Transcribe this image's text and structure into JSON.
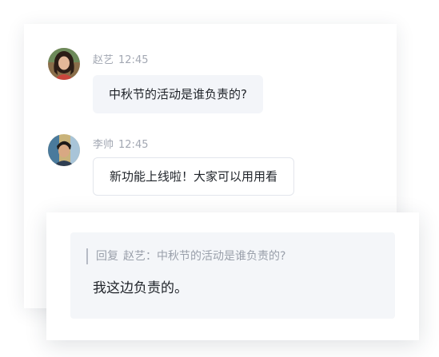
{
  "messages": [
    {
      "sender": "赵艺",
      "time": "12:45",
      "text": "中秋节的活动是谁负责的?",
      "avatar": "avatar-zhaoyi"
    },
    {
      "sender": "李帅",
      "time": "12:45",
      "text": "新功能上线啦！大家可以用用看",
      "avatar": "avatar-lishuai"
    }
  ],
  "reply": {
    "label": "回复",
    "quoted_sender": "赵艺",
    "separator": "：",
    "quoted_text": "中秋节的活动是谁负责的?",
    "text": "我这边负责的。"
  },
  "colors": {
    "bubble_fill": "#f3f5f9",
    "bubble_border": "#e3e6ec",
    "meta_text": "#a3a8b3",
    "body_text": "#1f2329",
    "reply_box": "#f4f6f9"
  }
}
